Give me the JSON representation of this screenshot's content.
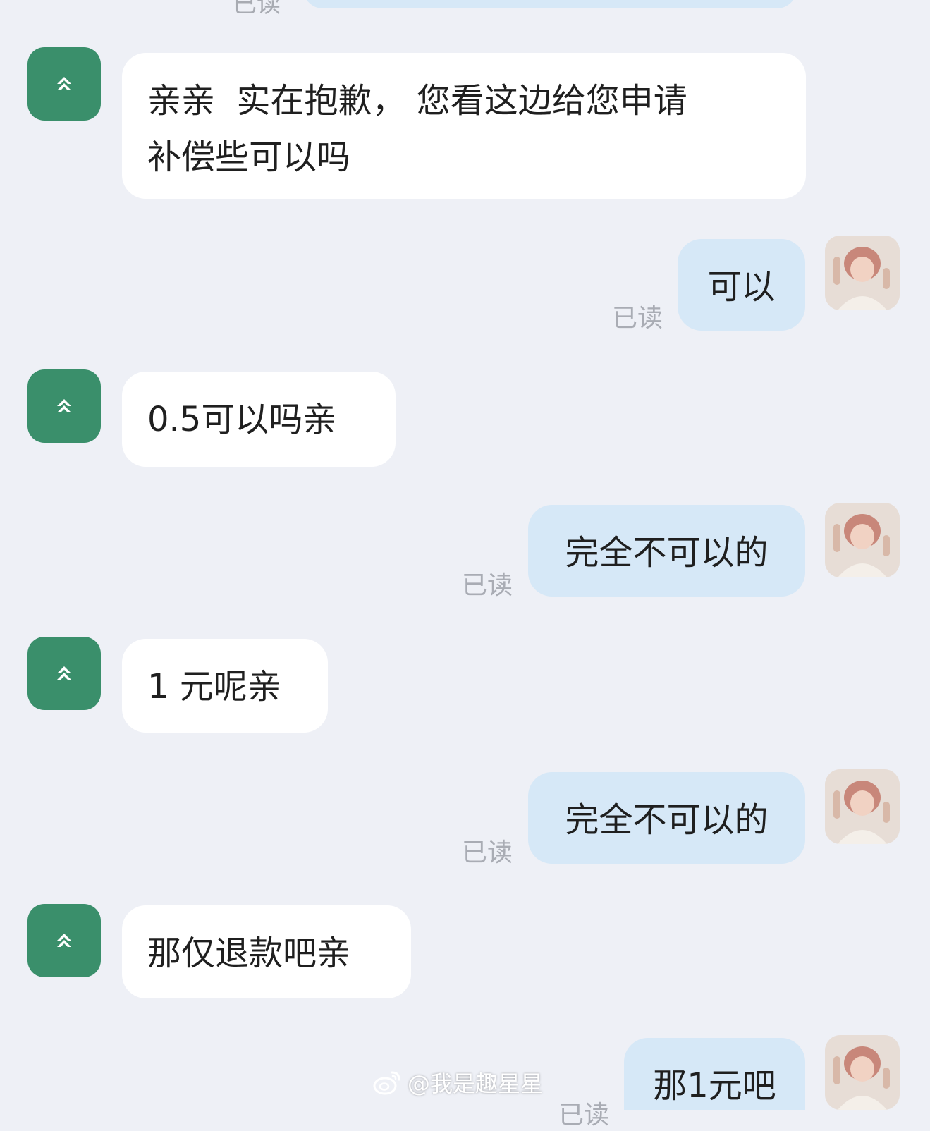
{
  "messages": [
    {
      "side": "in",
      "text": "亲亲  实在抱歉， 您看这边给您申请\n补偿些可以吗"
    },
    {
      "side": "out",
      "text": "可以",
      "status": "已读"
    },
    {
      "side": "in",
      "text": "0.5可以吗亲"
    },
    {
      "side": "out",
      "text": "完全不可以的",
      "status": "已读"
    },
    {
      "side": "in",
      "text": "1 元呢亲"
    },
    {
      "side": "out",
      "text": "完全不可以的",
      "status": "已读"
    },
    {
      "side": "in",
      "text": "那仅退款吧亲"
    },
    {
      "side": "out",
      "text": "那1元吧",
      "status": "已读"
    }
  ],
  "top_partial": {
    "status": "已读"
  },
  "watermark": {
    "icon": "weibo-icon",
    "text": "@我是趣星星"
  },
  "colors": {
    "background": "#eef0f6",
    "incoming_bubble": "#ffffff",
    "outgoing_bubble": "#d6e8f7",
    "shop_avatar": "#3a8f6b",
    "read_status": "#a9acb4"
  },
  "icons": {
    "shop_avatar": "shop-logo-icon",
    "user_avatar": "user-avatar"
  }
}
